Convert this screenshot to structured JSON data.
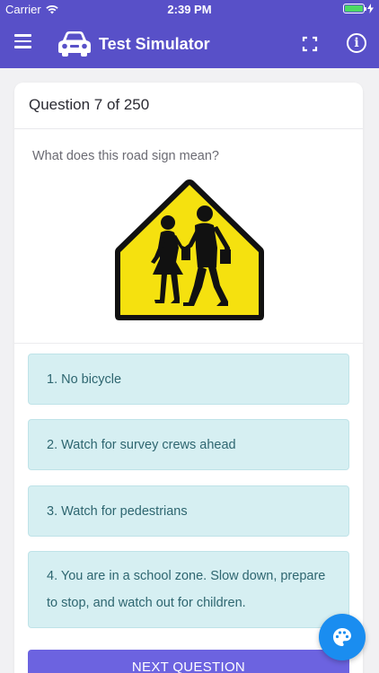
{
  "status_bar": {
    "carrier": "Carrier",
    "time": "2:39 PM",
    "battery_percent": 100
  },
  "app_bar": {
    "title": "Test Simulator",
    "info_symbol": "i",
    "icons": [
      "menu-icon",
      "car-icon",
      "fullscreen-icon",
      "info-icon"
    ]
  },
  "question": {
    "header": "Question 7 of 250",
    "text": "What does this road sign mean?",
    "image": "school-crossing-sign"
  },
  "answers": [
    {
      "label": "1. No bicycle"
    },
    {
      "label": "2. Watch for survey crews ahead"
    },
    {
      "label": "3. Watch for pedestrians"
    },
    {
      "label": "4. You are in a school zone. Slow down, prepare to stop, and watch out for children."
    }
  ],
  "next_button": {
    "label": "NEXT QUESTION"
  },
  "colors": {
    "primary": "#5850c8",
    "button": "#6c63e0",
    "answer_bg": "#d6eff2",
    "answer_text": "#2e6670",
    "fab": "#1a8df0",
    "sign_yellow": "#f5e10f"
  }
}
